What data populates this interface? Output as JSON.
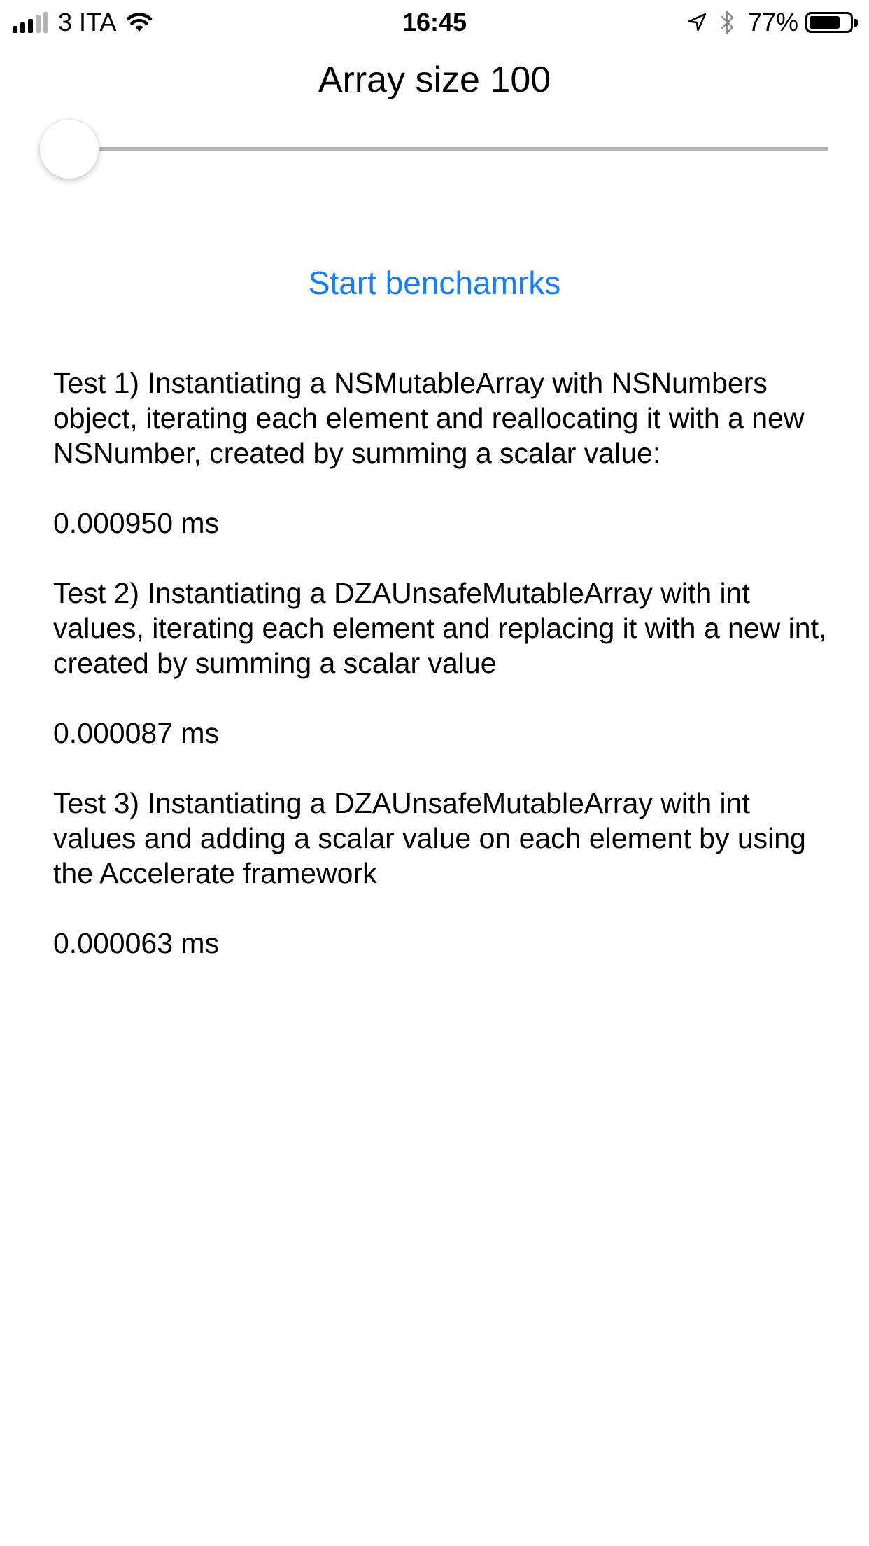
{
  "status_bar": {
    "carrier": "3 ITA",
    "signal_bars_active": 3,
    "signal_bars_total": 5,
    "time": "16:45",
    "battery_percent_label": "77%",
    "battery_level": 0.77,
    "icons": [
      "signal-icon",
      "wifi-icon",
      "location-arrow-icon",
      "bluetooth-icon",
      "battery-icon"
    ]
  },
  "array_size_label": "Array size 100",
  "slider": {
    "value_fraction": 0.0,
    "track_color": "#b7b7b7",
    "fill_color": "#147efb"
  },
  "start_button_label": "Start benchamrks",
  "accent_color": "#147efb",
  "tests": [
    {
      "description": "Test 1) Instantiating a NSMutableArray with NSNumbers object, iterating each element and reallocating it with a new NSNumber, created by summing a scalar value:",
      "result": "0.000950 ms"
    },
    {
      "description": "Test 2) Instantiating a DZAUnsafeMutableArray with int values, iterating each element and replacing it with a new int, created by summing a scalar value",
      "result": "0.000087 ms"
    },
    {
      "description": "Test 3) Instantiating a DZAUnsafeMutableArray with int values and adding a scalar value on each element by using the Accelerate framework",
      "result": "0.000063 ms"
    }
  ]
}
